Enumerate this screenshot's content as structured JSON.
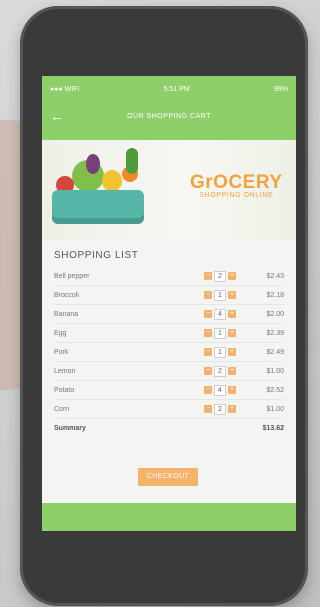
{
  "status": {
    "carrier": "●●● WIFI",
    "time": "5:51 PM",
    "battery": "99%"
  },
  "header": {
    "title": "OUR SHOPPING CART"
  },
  "banner": {
    "brand_name": "GrOCERY",
    "brand_tagline": "SHOPPING ONLINE"
  },
  "list": {
    "title": "SHOPPING LIST",
    "items": [
      {
        "name": "Bell pepper",
        "qty": "2",
        "price": "$2.43"
      },
      {
        "name": "Broccoli",
        "qty": "1",
        "price": "$2.18"
      },
      {
        "name": "Banana",
        "qty": "4",
        "price": "$2.00"
      },
      {
        "name": "Egg",
        "qty": "1",
        "price": "$2.39"
      },
      {
        "name": "Pork",
        "qty": "1",
        "price": "$2.49"
      },
      {
        "name": "Lemon",
        "qty": "2",
        "price": "$1.00"
      },
      {
        "name": "Potato",
        "qty": "4",
        "price": "$2.52"
      },
      {
        "name": "Corn",
        "qty": "2",
        "price": "$1.00"
      }
    ],
    "summary_label": "Summary",
    "summary_value": "$13.62"
  },
  "checkout_label": "CHECKOUT",
  "colors": {
    "green": "#8fcf6a",
    "orange": "#f0a340"
  }
}
